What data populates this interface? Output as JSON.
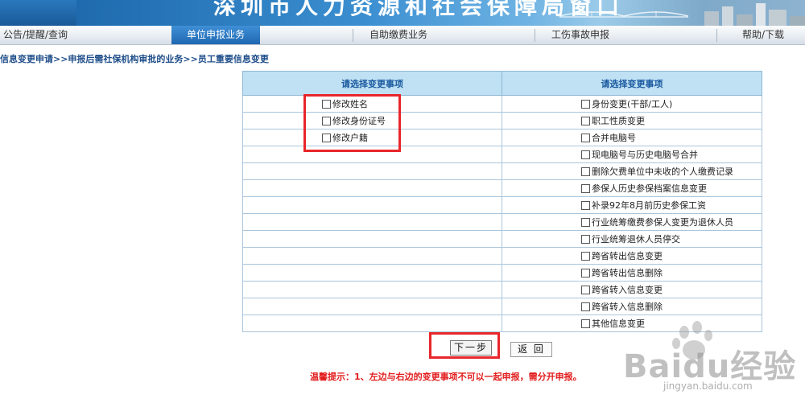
{
  "banner": {
    "title": "深圳市人力资源和社会保障局窗口"
  },
  "nav": {
    "items": [
      {
        "label": "公告/提醒/查询"
      },
      {
        "label": "单位申报业务"
      },
      {
        "label": "自助缴费业务"
      },
      {
        "label": "工伤事故申报"
      },
      {
        "label": "帮助/下载"
      }
    ]
  },
  "breadcrumb": "信息变更申请>>申报后需社保机构审批的业务>>员工重要信息变更",
  "table": {
    "headers": [
      "请选择变更事项",
      "请选择变更事项"
    ],
    "left_options": [
      "修改姓名",
      "修改身份证号",
      "修改户籍"
    ],
    "right_options": [
      "身份变更(干部/工人)",
      "职工性质变更",
      "合并电脑号",
      "现电脑号与历史电脑号合并",
      "删除欠费单位中未收的个人缴费记录",
      "参保人历史参保档案信息变更",
      "补录92年8月前历史参保工资",
      "行业统筹缴费参保人变更为退休人员",
      "行业统筹退休人员停交",
      "跨省转出信息变更",
      "跨省转出信息删除",
      "跨省转入信息变更",
      "跨省转入信息删除",
      "其他信息变更"
    ]
  },
  "buttons": {
    "next": "下一步",
    "back": "返 回"
  },
  "tip": "温馨提示：1、左边与右边的变更事项不可以一起申报，需分开申报。",
  "watermark": {
    "logo": "Baidu经验",
    "url": "jingyan.baidu.com"
  },
  "colors": {
    "highlight": "#e8262b",
    "nav_active": "#1f68b2",
    "header_bg": "#bfe1f3",
    "tip": "#e21b1b"
  }
}
